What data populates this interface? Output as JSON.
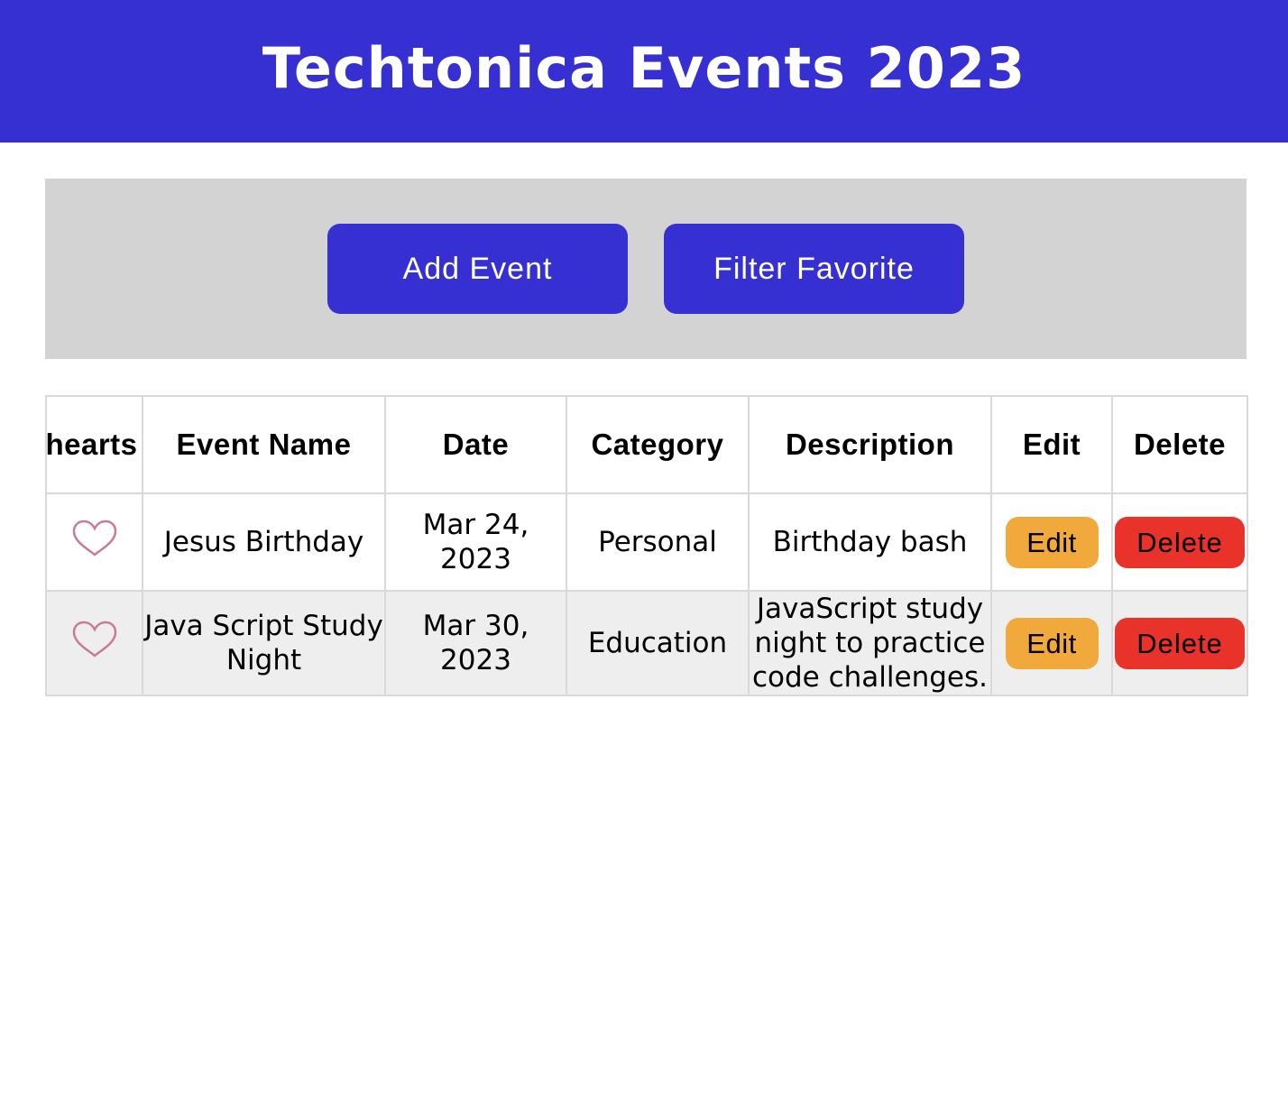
{
  "header": {
    "title": "Techtonica Events 2023"
  },
  "toolbar": {
    "add_label": "Add Event",
    "filter_label": "Filter Favorite"
  },
  "table": {
    "columns": [
      "hearts",
      "Event Name",
      "Date",
      "Category",
      "Description",
      "Edit",
      "Delete"
    ],
    "rows": [
      {
        "heart": "heart-outline-icon",
        "name": "Jesus Birthday",
        "date": "Mar 24, 2023",
        "category": "Personal",
        "description": "Birthday bash",
        "edit_label": "Edit",
        "delete_label": "Delete"
      },
      {
        "heart": "heart-outline-icon",
        "name": "Java Script Study Night",
        "date": "Mar 30, 2023",
        "category": "Education",
        "description": "JavaScript study night to practice code challenges.",
        "edit_label": "Edit",
        "delete_label": "Delete"
      }
    ]
  },
  "colors": {
    "brand": "#3630d3",
    "toolbar_bg": "#d3d3d3",
    "edit": "#f2a93b",
    "delete": "#e8322a",
    "heart": "#c97a98"
  }
}
